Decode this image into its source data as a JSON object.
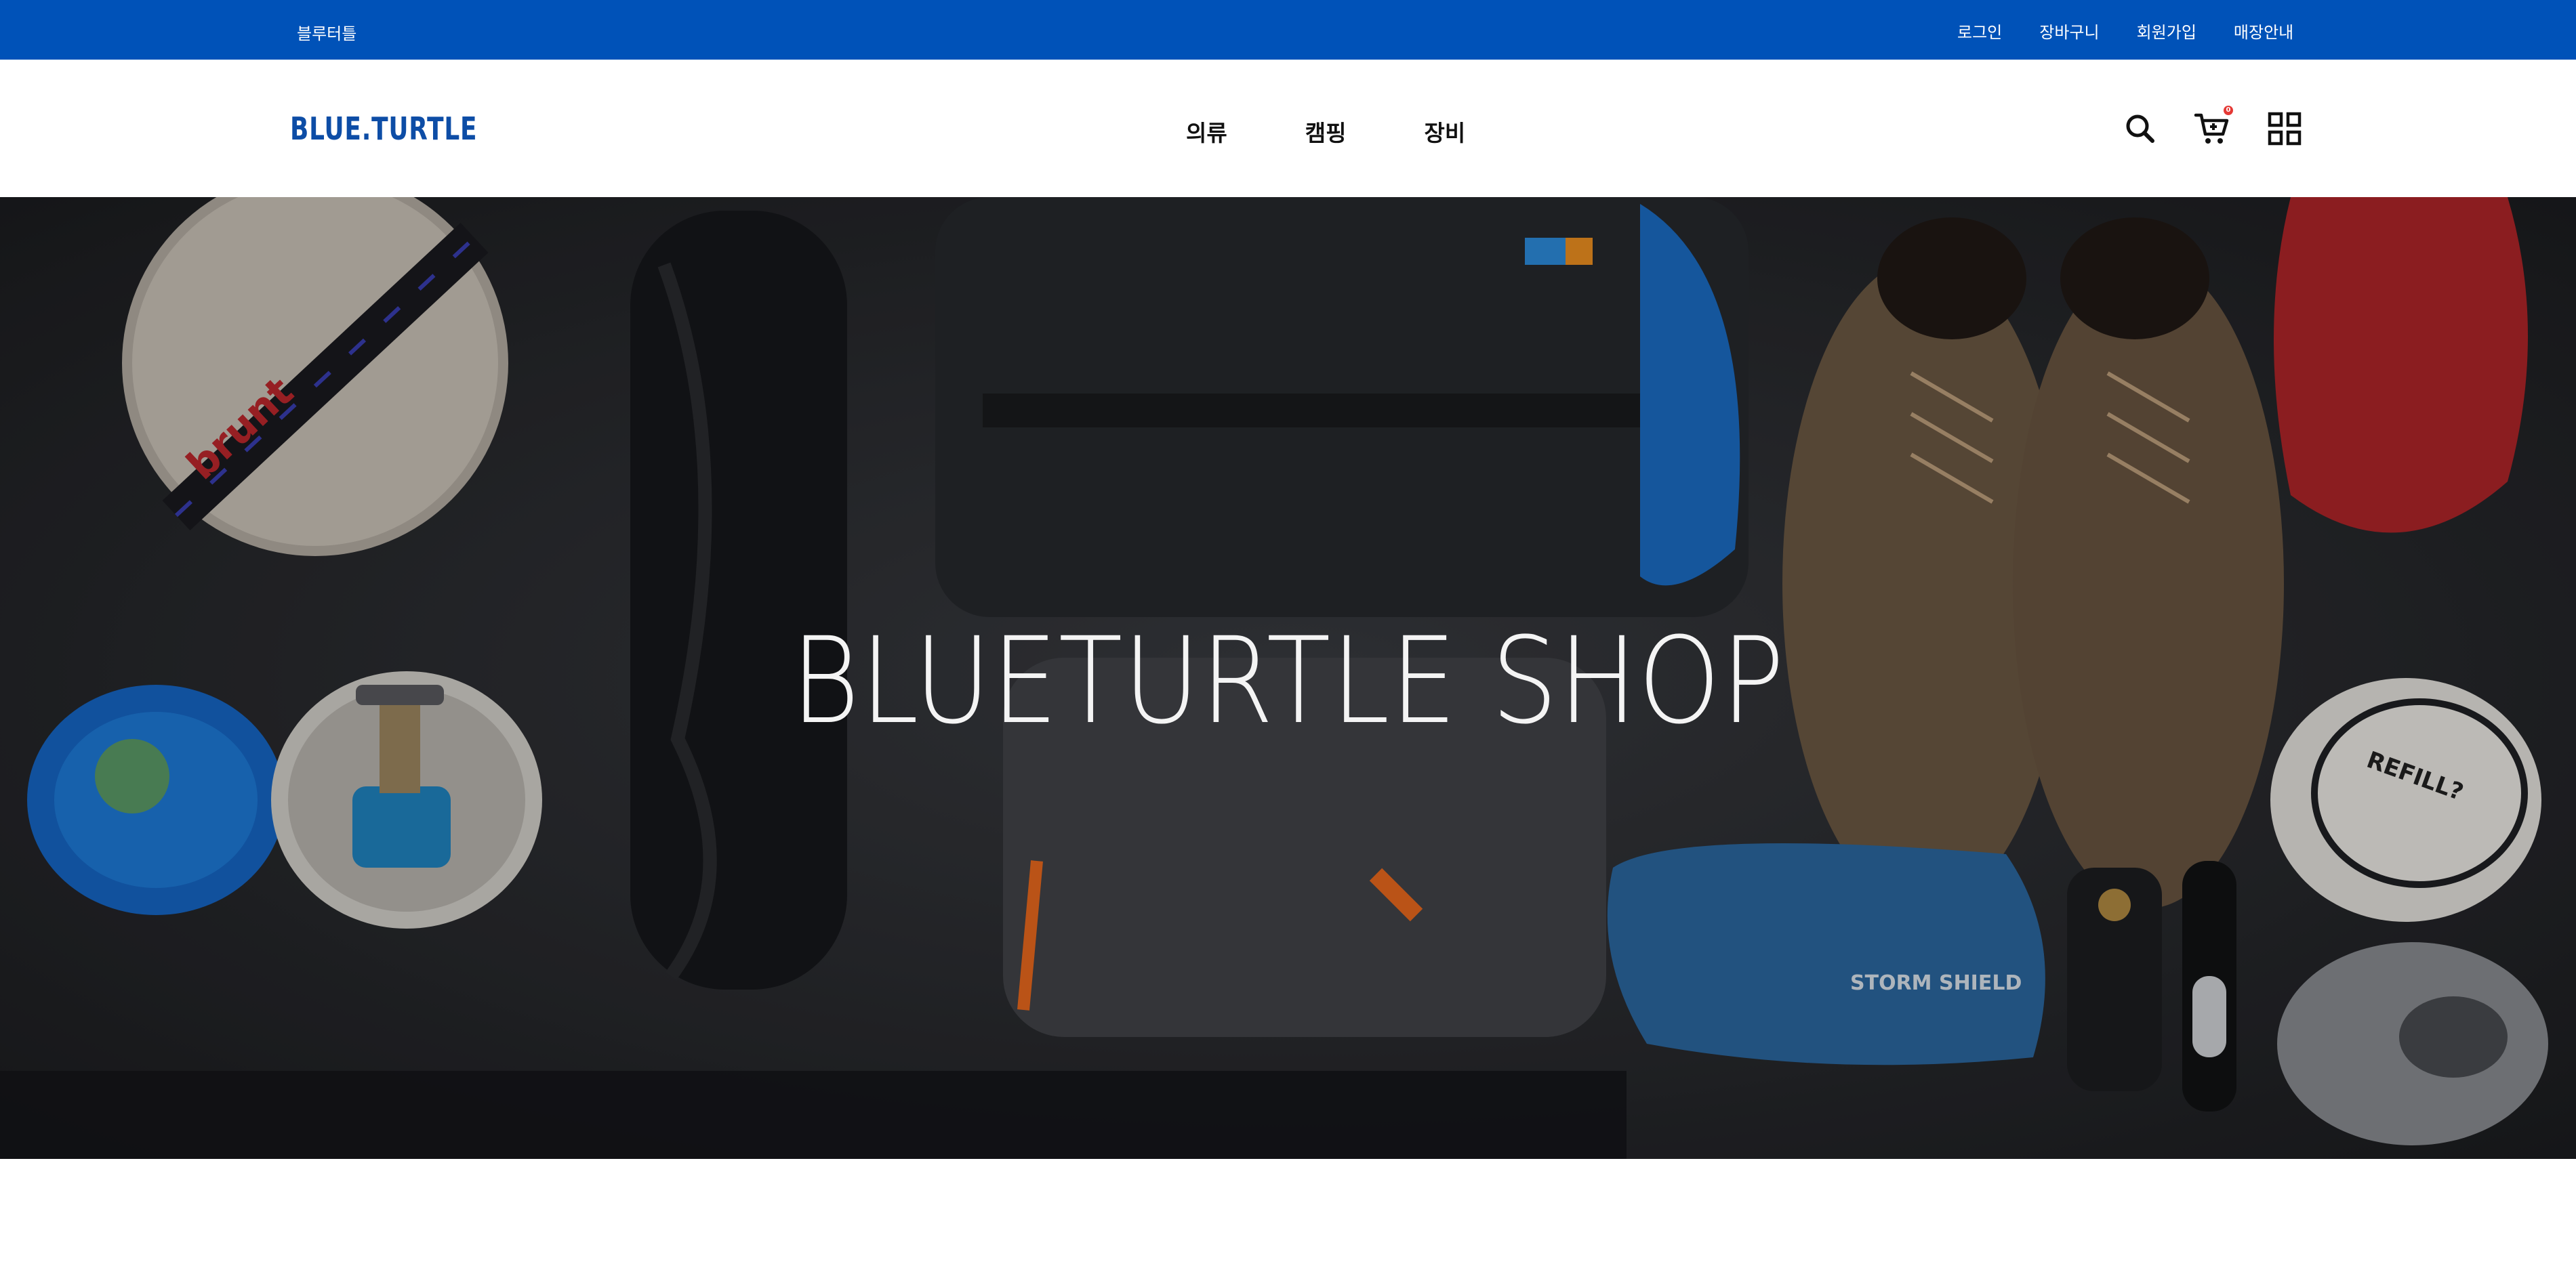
{
  "topbar": {
    "brand": "블루터틀",
    "links": [
      "로그인",
      "장바구니",
      "회원가입",
      "매장안내"
    ]
  },
  "header": {
    "logo_text": "BLUE.TURTLE",
    "nav": [
      "의류",
      "캠핑",
      "장비"
    ],
    "cart_badge": "0",
    "icons": [
      "search-icon",
      "cart-icon",
      "grid-menu-icon"
    ]
  },
  "hero": {
    "title": "BLUETURTLE SHOP",
    "scene_text": {
      "pot_strap": "brunt",
      "mug": "REFILL?",
      "pouch": "STORM SHIELD"
    }
  },
  "colors": {
    "accent": "#0052b8",
    "logo": "#0d4da6",
    "badge": "#e53935",
    "hero_bg": "#2b2d31"
  }
}
